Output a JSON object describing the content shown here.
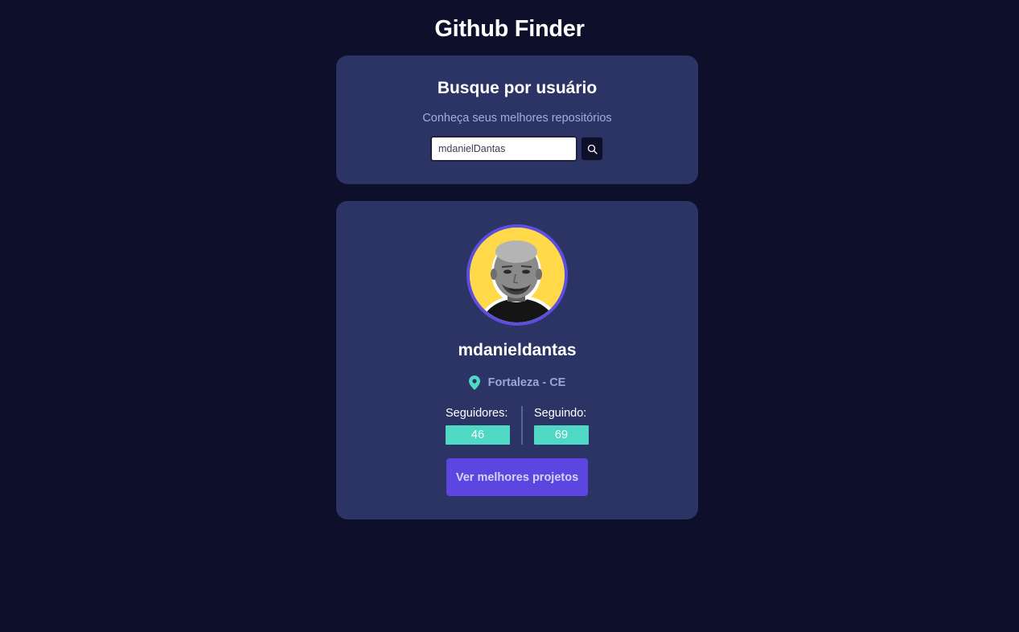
{
  "app": {
    "title": "Github Finder"
  },
  "search": {
    "title": "Busque por usuário",
    "subtitle": "Conheça seus melhores repositórios",
    "input_value": "mdanielDantas",
    "button_icon": "search-icon"
  },
  "profile": {
    "username": "mdanieldantas",
    "location_icon": "map-pin-icon",
    "location": "Fortaleza - CE",
    "followers_label": "Seguidores:",
    "followers": "46",
    "following_label": "Seguindo:",
    "following": "69",
    "projects_button": "Ver melhores projetos"
  },
  "colors": {
    "background": "#0e0f2a",
    "card": "#2c3466",
    "accent": "#5c45e0",
    "teal": "#4fd8c4",
    "avatar_ring": "#5c4ee0",
    "avatar_bg": "#ffd94a"
  }
}
